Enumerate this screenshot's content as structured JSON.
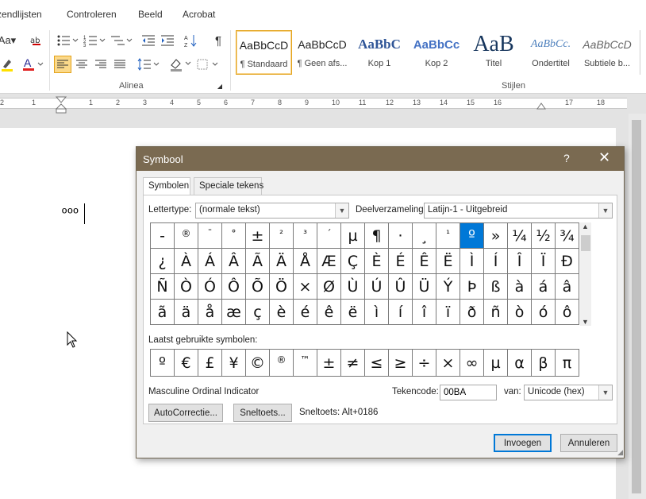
{
  "ribbon": {
    "tabs": [
      "zendlijsten",
      "Controleren",
      "Beeld",
      "Acrobat"
    ],
    "groups": {
      "paragraph": "Alinea",
      "styles": "Stijlen"
    },
    "styles": [
      {
        "preview": "AaBbCcD",
        "name": "¶ Standaard"
      },
      {
        "preview": "AaBbCcD",
        "name": "¶ Geen afs..."
      },
      {
        "preview": "AaBbC",
        "name": "Kop 1"
      },
      {
        "preview": "AaBbCc",
        "name": "Kop 2"
      },
      {
        "preview": "AaB",
        "name": "Titel"
      },
      {
        "preview": "AaBbCc.",
        "name": "Ondertitel"
      },
      {
        "preview": "AaBbCcD",
        "name": "Subtiele b..."
      }
    ]
  },
  "ruler": {
    "numbers": [
      "2",
      "1",
      "1",
      "2",
      "3",
      "4",
      "5",
      "6",
      "7",
      "8",
      "9",
      "10",
      "11",
      "12",
      "13",
      "14",
      "15",
      "16",
      "17",
      "18"
    ]
  },
  "document": {
    "text": "ººº"
  },
  "dialog": {
    "title": "Symbool",
    "help": "?",
    "close": "✕",
    "tabs": [
      "Symbolen",
      "Speciale tekens"
    ],
    "font_label": "Lettertype:",
    "font_value": "(normale tekst)",
    "subset_label": "Deelverzameling:",
    "subset_value": "Latijn-1 - Uitgebreid",
    "symbols": [
      [
        "-",
        "®",
        "¯",
        "°",
        "±",
        "²",
        "³",
        "´",
        "µ",
        "¶",
        "·",
        "¸",
        "¹",
        "º",
        "»",
        "¼",
        "½",
        "¾"
      ],
      [
        "¿",
        "À",
        "Á",
        "Â",
        "Ã",
        "Ä",
        "Å",
        "Æ",
        "Ç",
        "È",
        "É",
        "Ê",
        "Ë",
        "Ì",
        "Í",
        "Î",
        "Ï",
        "Ð"
      ],
      [
        "Ñ",
        "Ò",
        "Ó",
        "Ô",
        "Õ",
        "Ö",
        "×",
        "Ø",
        "Ù",
        "Ú",
        "Û",
        "Ü",
        "Ý",
        "Þ",
        "ß",
        "à",
        "á",
        "â"
      ],
      [
        "ã",
        "ä",
        "å",
        "æ",
        "ç",
        "è",
        "é",
        "ê",
        "ë",
        "ì",
        "í",
        "î",
        "ï",
        "ð",
        "ñ",
        "ò",
        "ó",
        "ô"
      ]
    ],
    "selected_symbol": "º",
    "recent_label": "Laatst gebruikte symbolen:",
    "recent": [
      "º",
      "€",
      "£",
      "¥",
      "©",
      "®",
      "™",
      "±",
      "≠",
      "≤",
      "≥",
      "÷",
      "×",
      "∞",
      "µ",
      "α",
      "β",
      "π"
    ],
    "char_name": "Masculine Ordinal Indicator",
    "code_label": "Tekencode:",
    "code_value": "00BA",
    "from_label": "van:",
    "from_value": "Unicode (hex)",
    "autocorrect_button": "AutoCorrectie...",
    "shortcut_button": "Sneltoets...",
    "shortcut_text": "Sneltoets: Alt+0186",
    "insert_button": "Invoegen",
    "cancel_button": "Annuleren"
  },
  "colors": {
    "title_bar": "#7a6a51",
    "selection": "#0078d7",
    "highlight": "#fbd98a"
  }
}
